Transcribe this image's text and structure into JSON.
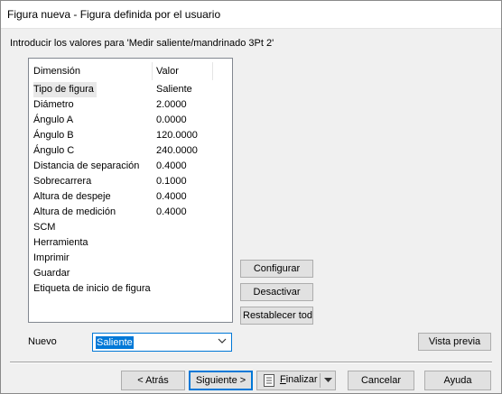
{
  "window": {
    "title": "Figura nueva - Figura definida por el usuario"
  },
  "instruction": "Introducir los valores para 'Medir saliente/mandrinado 3Pt 2'",
  "table": {
    "headers": {
      "dimension": "Dimensión",
      "value": "Valor"
    },
    "rows": [
      {
        "dimension": "Tipo de figura",
        "value": "Saliente"
      },
      {
        "dimension": "Diámetro",
        "value": "2.0000"
      },
      {
        "dimension": "Ángulo A",
        "value": "0.0000"
      },
      {
        "dimension": "Ángulo B",
        "value": "120.0000"
      },
      {
        "dimension": "Ángulo C",
        "value": "240.0000"
      },
      {
        "dimension": "Distancia de separación",
        "value": "0.4000"
      },
      {
        "dimension": "Sobrecarrera",
        "value": "0.1000"
      },
      {
        "dimension": "Altura de despeje",
        "value": "0.4000"
      },
      {
        "dimension": "Altura de medición",
        "value": "0.4000"
      },
      {
        "dimension": "SCM",
        "value": ""
      },
      {
        "dimension": "Herramienta",
        "value": ""
      },
      {
        "dimension": "Imprimir",
        "value": ""
      },
      {
        "dimension": "Guardar",
        "value": ""
      },
      {
        "dimension": "Etiqueta de inicio de figura",
        "value": ""
      }
    ]
  },
  "side_buttons": {
    "configurar": "Configurar",
    "desactivar": "Desactivar",
    "restablecer": "Restablecer todo"
  },
  "nuevo": {
    "label": "Nuevo",
    "selected": "Saliente"
  },
  "vista_previa": "Vista previa",
  "footer": {
    "atras": "< Atrás",
    "siguiente": "Siguiente >",
    "finalizar_prefix": "F",
    "finalizar_rest": "inalizar",
    "cancelar": "Cancelar",
    "ayuda": "Ayuda"
  },
  "colors": {
    "accent": "#0078d7",
    "button_face": "#e1e1e1",
    "dialog_bg": "#f0f0f0"
  }
}
